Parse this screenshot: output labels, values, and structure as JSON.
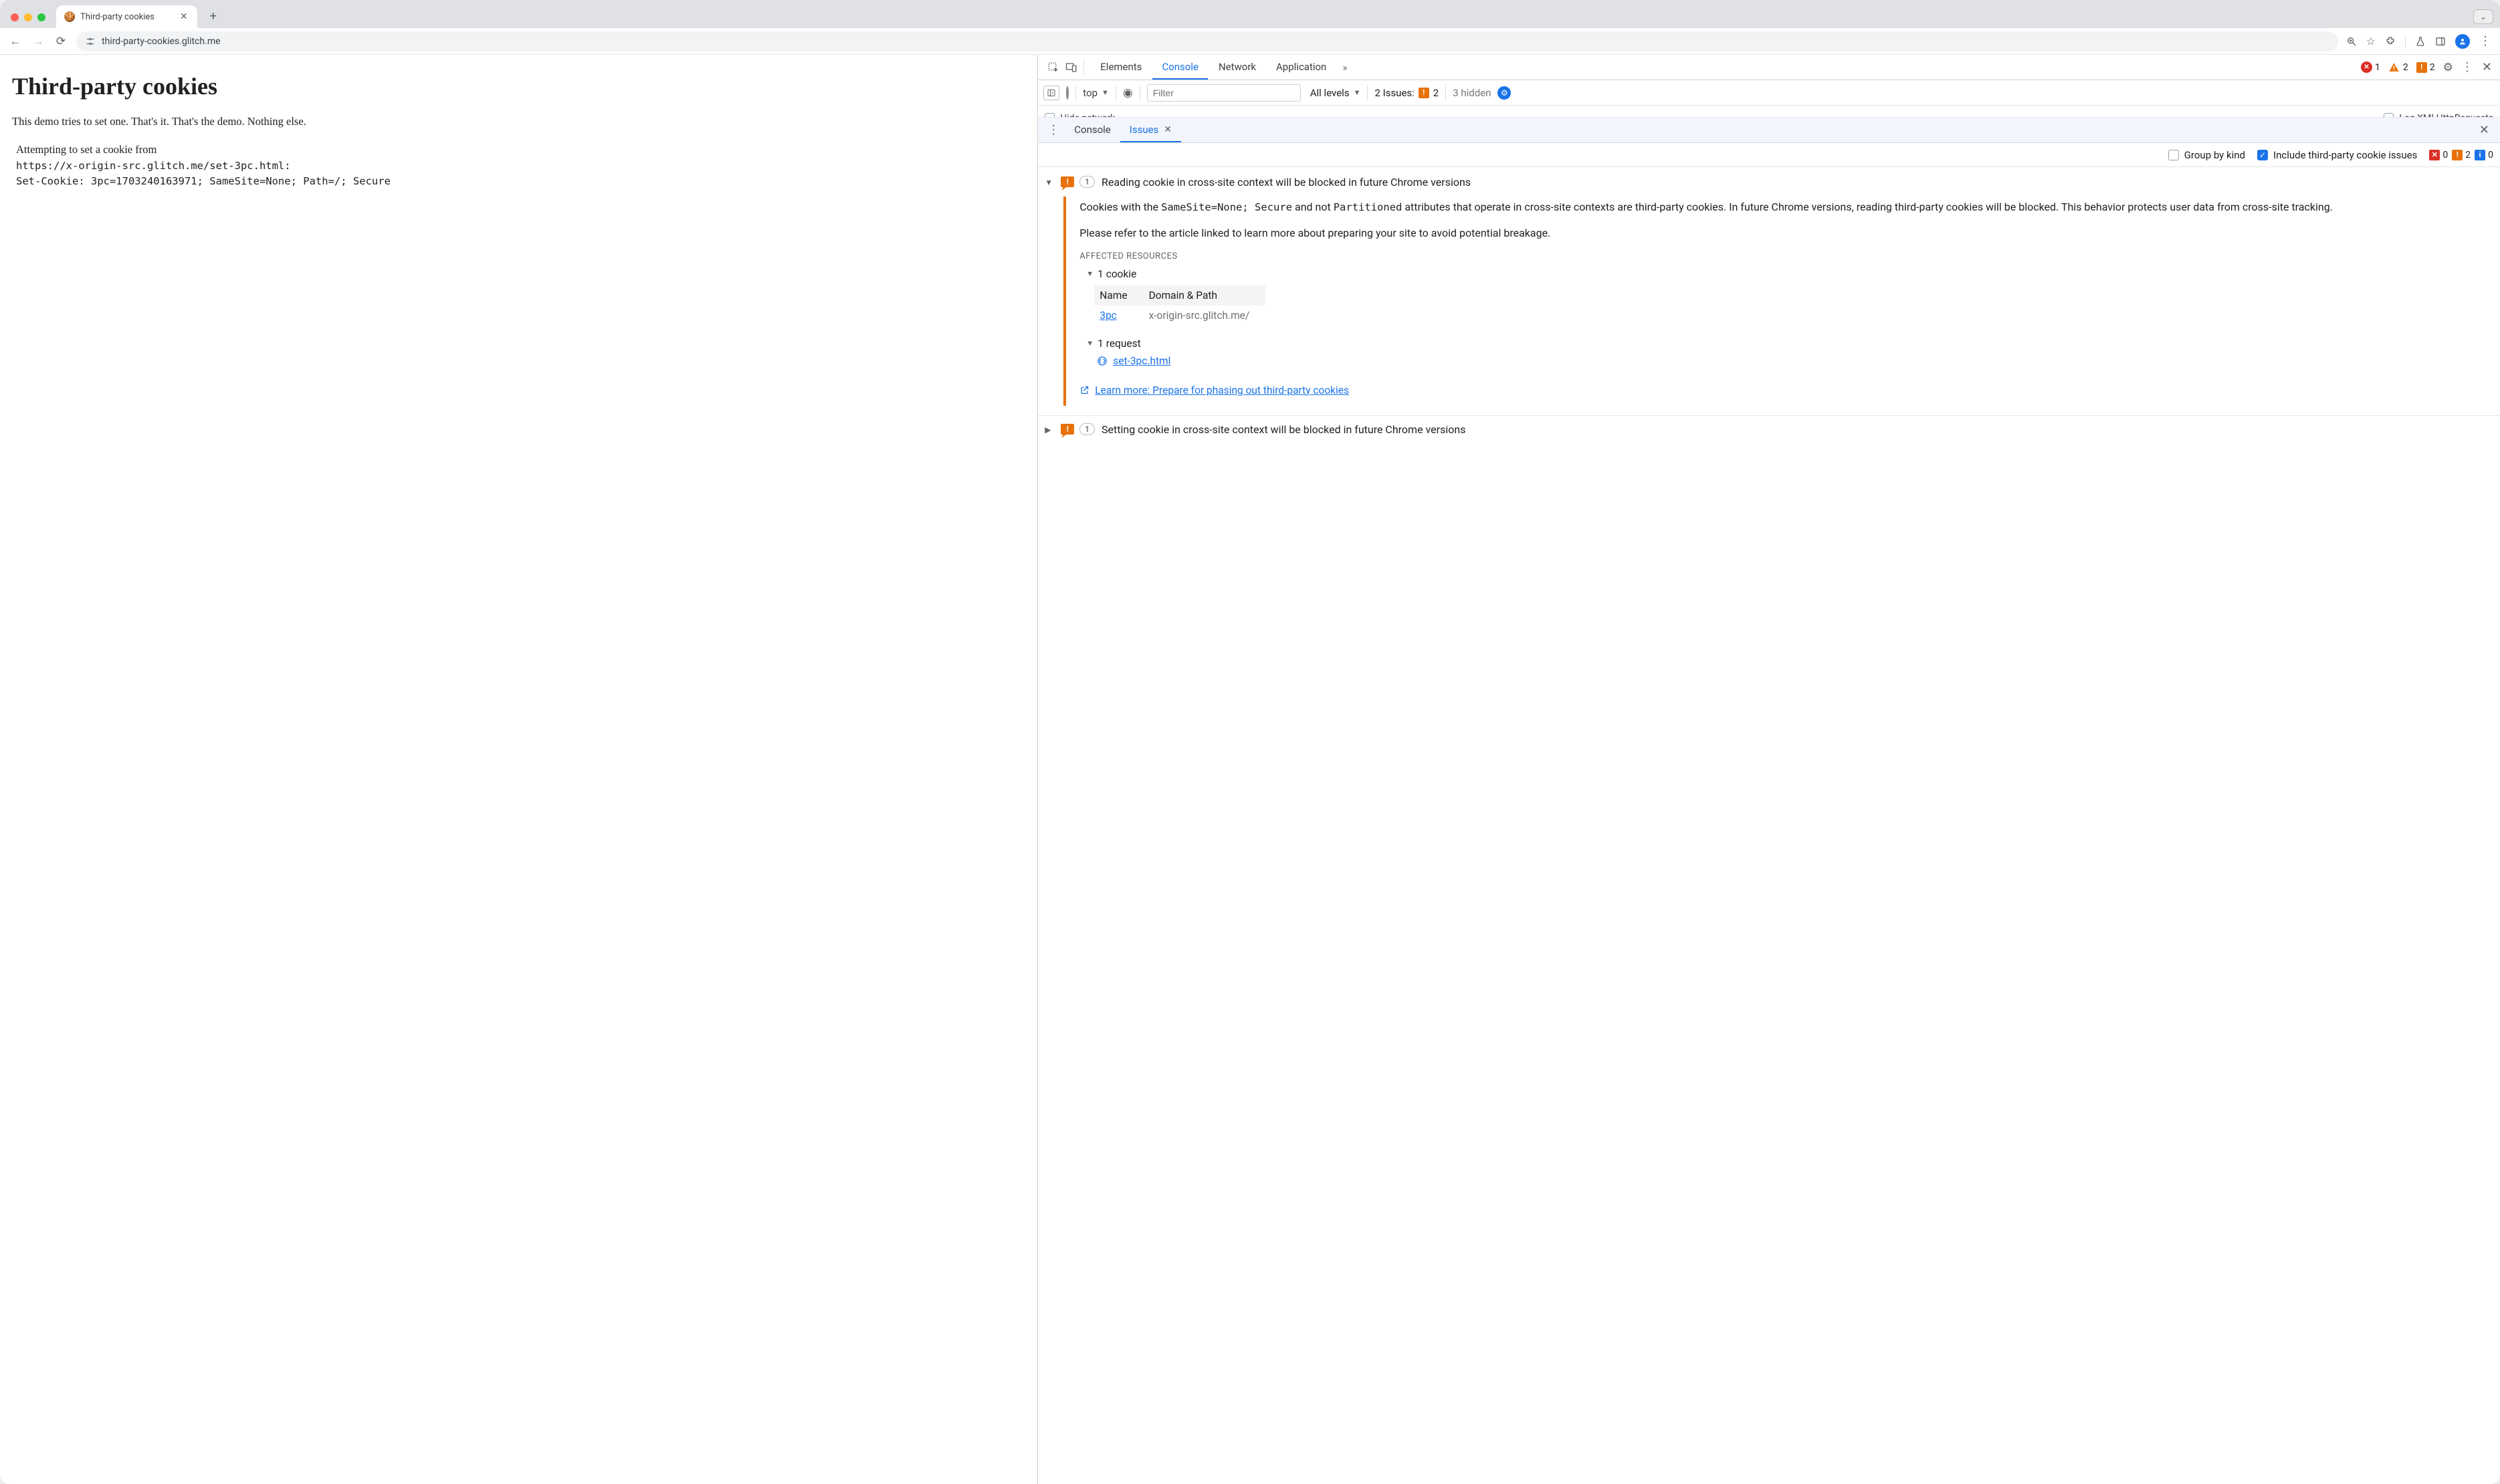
{
  "browser": {
    "tab_title": "Third-party cookies",
    "url": "third-party-cookies.glitch.me"
  },
  "page": {
    "heading": "Third-party cookies",
    "intro": "This demo tries to set one. That's it. That's the demo. Nothing else.",
    "pre_line1": "Attempting to set a cookie from",
    "pre_line2": "https://x-origin-src.glitch.me/set-3pc.html:",
    "pre_line3": "Set-Cookie: 3pc=1703240163971; SameSite=None; Path=/; Secure"
  },
  "devtools": {
    "tabs": {
      "elements": "Elements",
      "console": "Console",
      "network": "Network",
      "application": "Application"
    },
    "counts": {
      "errors": "1",
      "warnings": "2",
      "issues": "2"
    },
    "filter": {
      "context": "top",
      "placeholder": "Filter",
      "levels": "All levels",
      "issues_label": "2 Issues:",
      "issues_badge": "2",
      "hidden": "3 hidden"
    },
    "options": {
      "hide": "Hide network",
      "xhr": "Log XMLHttpRequests"
    },
    "drawer": {
      "console": "Console",
      "issues": "Issues"
    },
    "issues_toolbar": {
      "group": "Group by kind",
      "include": "Include third-party cookie issues",
      "red": "0",
      "orange": "2",
      "blue": "0"
    },
    "issue1": {
      "count": "1",
      "title": "Reading cookie in cross-site context will be blocked in future Chrome versions",
      "para1_a": "Cookies with the ",
      "para1_code1": "SameSite=None; Secure",
      "para1_b": " and not ",
      "para1_code2": "Partitioned",
      "para1_c": " attributes that operate in cross-site contexts are third-party cookies. In future Chrome versions, reading third-party cookies will be blocked. This behavior protects user data from cross-site tracking.",
      "para2": "Please refer to the article linked to learn more about preparing your site to avoid potential breakage.",
      "aff_heading": "AFFECTED RESOURCES",
      "sub_cookie": "1 cookie",
      "th_name": "Name",
      "th_domain": "Domain & Path",
      "cookie_name": "3pc",
      "cookie_path": "x-origin-src.glitch.me/",
      "sub_request": "1 request",
      "request_name": "set-3pc.html",
      "learn_label": "Learn more: Prepare for phasing out third-party cookies"
    },
    "issue2": {
      "count": "1",
      "title": "Setting cookie in cross-site context will be blocked in future Chrome versions"
    }
  }
}
